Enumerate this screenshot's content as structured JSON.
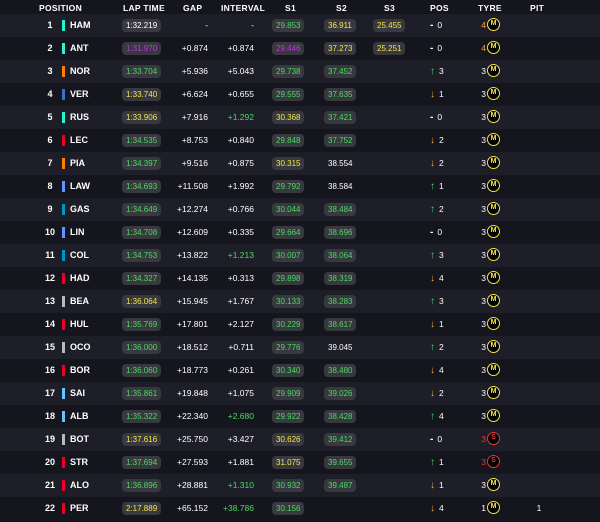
{
  "header": {
    "position": "POSITION",
    "lap_time": "LAP TIME",
    "gap": "GAP",
    "interval": "INTERVAL",
    "s1": "S1",
    "s2": "S2",
    "s3": "S3",
    "pos": "POS",
    "tyre": "TYRE",
    "pit": "PIT"
  },
  "colors": {
    "purple": "#c930e8",
    "green": "#4cd964",
    "yellow": "#f4e64a",
    "medium_tyre": "#f4e64a",
    "soft_tyre": "#e23a3a"
  },
  "rows": [
    {
      "pos": "1",
      "code": "HAM",
      "team": "#27f4d2",
      "lap": "1:32.219",
      "lap_c": "white",
      "gap": "-",
      "int": "-",
      "int_c": "white",
      "s1": "29.853",
      "s1_c": "green",
      "s2": "36.911",
      "s2_c": "yellow",
      "s3": "25.455",
      "s3_c": "yellow",
      "dir": "none",
      "pc": "0",
      "tl": "4",
      "tl_c": "orange",
      "tyre": "M",
      "pit": ""
    },
    {
      "pos": "2",
      "code": "ANT",
      "team": "#27f4d2",
      "lap": "1:31.970",
      "lap_c": "purple",
      "gap": "+0.874",
      "int": "+0.874",
      "int_c": "white",
      "s1": "29.446",
      "s1_c": "purple",
      "s2": "37.273",
      "s2_c": "yellow",
      "s3": "25.251",
      "s3_c": "yellow",
      "dir": "none",
      "pc": "0",
      "tl": "4",
      "tl_c": "orange",
      "tyre": "M",
      "pit": ""
    },
    {
      "pos": "3",
      "code": "NOR",
      "team": "#ff8000",
      "lap": "1:33.704",
      "lap_c": "green",
      "gap": "+5.936",
      "int": "+5.043",
      "int_c": "white",
      "s1": "29.738",
      "s1_c": "green",
      "s2": "37.452",
      "s2_c": "green",
      "s3": "",
      "s3_c": "white",
      "dir": "up",
      "pc": "3",
      "tl": "3",
      "tl_c": "white",
      "tyre": "M",
      "pit": ""
    },
    {
      "pos": "4",
      "code": "VER",
      "team": "#3671c6",
      "lap": "1:33.740",
      "lap_c": "yellow",
      "gap": "+6.624",
      "int": "+0.655",
      "int_c": "white",
      "s1": "29.555",
      "s1_c": "green",
      "s2": "37.635",
      "s2_c": "green",
      "s3": "",
      "s3_c": "white",
      "dir": "down",
      "pc": "1",
      "tl": "3",
      "tl_c": "white",
      "tyre": "M",
      "pit": ""
    },
    {
      "pos": "5",
      "code": "RUS",
      "team": "#27f4d2",
      "lap": "1:33.906",
      "lap_c": "yellow",
      "gap": "+7.916",
      "int": "+1.292",
      "int_c": "green",
      "s1": "30.368",
      "s1_c": "yellow",
      "s2": "37.421",
      "s2_c": "green",
      "s3": "",
      "s3_c": "white",
      "dir": "none",
      "pc": "0",
      "tl": "3",
      "tl_c": "white",
      "tyre": "M",
      "pit": ""
    },
    {
      "pos": "6",
      "code": "LEC",
      "team": "#e8002d",
      "lap": "1:34.535",
      "lap_c": "green",
      "gap": "+8.753",
      "int": "+0.840",
      "int_c": "white",
      "s1": "29.848",
      "s1_c": "green",
      "s2": "37.752",
      "s2_c": "green",
      "s3": "",
      "s3_c": "white",
      "dir": "down",
      "pc": "2",
      "tl": "3",
      "tl_c": "white",
      "tyre": "M",
      "pit": ""
    },
    {
      "pos": "7",
      "code": "PIA",
      "team": "#ff8000",
      "lap": "1:34.397",
      "lap_c": "green",
      "gap": "+9.516",
      "int": "+0.875",
      "int_c": "white",
      "s1": "30.315",
      "s1_c": "yellow",
      "s2": "38.554",
      "s2_c": "white",
      "s3": "",
      "s3_c": "white",
      "dir": "down",
      "pc": "2",
      "tl": "3",
      "tl_c": "white",
      "tyre": "M",
      "pit": ""
    },
    {
      "pos": "8",
      "code": "LAW",
      "team": "#6692ff",
      "lap": "1:34.693",
      "lap_c": "green",
      "gap": "+11.508",
      "int": "+1.992",
      "int_c": "white",
      "s1": "29.792",
      "s1_c": "green",
      "s2": "38.584",
      "s2_c": "white",
      "s3": "",
      "s3_c": "white",
      "dir": "up",
      "pc": "1",
      "tl": "3",
      "tl_c": "white",
      "tyre": "M",
      "pit": ""
    },
    {
      "pos": "9",
      "code": "GAS",
      "team": "#0093cc",
      "lap": "1:34.649",
      "lap_c": "green",
      "gap": "+12.274",
      "int": "+0.766",
      "int_c": "white",
      "s1": "30.044",
      "s1_c": "green",
      "s2": "38.484",
      "s2_c": "green",
      "s3": "",
      "s3_c": "white",
      "dir": "up",
      "pc": "2",
      "tl": "3",
      "tl_c": "white",
      "tyre": "M",
      "pit": ""
    },
    {
      "pos": "10",
      "code": "LIN",
      "team": "#6692ff",
      "lap": "1:34.708",
      "lap_c": "green",
      "gap": "+12.609",
      "int": "+0.335",
      "int_c": "white",
      "s1": "29.664",
      "s1_c": "green",
      "s2": "38.696",
      "s2_c": "green",
      "s3": "",
      "s3_c": "white",
      "dir": "none",
      "pc": "0",
      "tl": "3",
      "tl_c": "white",
      "tyre": "M",
      "pit": ""
    },
    {
      "pos": "11",
      "code": "COL",
      "team": "#0093cc",
      "lap": "1:34.753",
      "lap_c": "green",
      "gap": "+13.822",
      "int": "+1.213",
      "int_c": "green",
      "s1": "30.007",
      "s1_c": "green",
      "s2": "38.064",
      "s2_c": "green",
      "s3": "",
      "s3_c": "white",
      "dir": "up",
      "pc": "3",
      "tl": "3",
      "tl_c": "white",
      "tyre": "M",
      "pit": ""
    },
    {
      "pos": "12",
      "code": "HAD",
      "team": "#e8002d",
      "lap": "1:34.327",
      "lap_c": "green",
      "gap": "+14.135",
      "int": "+0.313",
      "int_c": "white",
      "s1": "29.898",
      "s1_c": "green",
      "s2": "38.319",
      "s2_c": "green",
      "s3": "",
      "s3_c": "white",
      "dir": "down",
      "pc": "4",
      "tl": "3",
      "tl_c": "white",
      "tyre": "M",
      "pit": ""
    },
    {
      "pos": "13",
      "code": "BEA",
      "team": "#b6babd",
      "lap": "1:36.064",
      "lap_c": "yellow",
      "gap": "+15.945",
      "int": "+1.767",
      "int_c": "white",
      "s1": "30.133",
      "s1_c": "green",
      "s2": "38.283",
      "s2_c": "green",
      "s3": "",
      "s3_c": "white",
      "dir": "up",
      "pc": "3",
      "tl": "3",
      "tl_c": "white",
      "tyre": "M",
      "pit": ""
    },
    {
      "pos": "14",
      "code": "HUL",
      "team": "#e8002d",
      "lap": "1:35.769",
      "lap_c": "green",
      "gap": "+17.801",
      "int": "+2.127",
      "int_c": "white",
      "s1": "30.229",
      "s1_c": "green",
      "s2": "38.617",
      "s2_c": "green",
      "s3": "",
      "s3_c": "white",
      "dir": "down",
      "pc": "1",
      "tl": "3",
      "tl_c": "white",
      "tyre": "M",
      "pit": ""
    },
    {
      "pos": "15",
      "code": "OCO",
      "team": "#b6babd",
      "lap": "1:36.000",
      "lap_c": "green",
      "gap": "+18.512",
      "int": "+0.711",
      "int_c": "white",
      "s1": "29.776",
      "s1_c": "green",
      "s2": "39.045",
      "s2_c": "white",
      "s3": "",
      "s3_c": "white",
      "dir": "up",
      "pc": "2",
      "tl": "3",
      "tl_c": "white",
      "tyre": "M",
      "pit": ""
    },
    {
      "pos": "16",
      "code": "BOR",
      "team": "#e8002d",
      "lap": "1:36.060",
      "lap_c": "green",
      "gap": "+18.773",
      "int": "+0.261",
      "int_c": "white",
      "s1": "30.340",
      "s1_c": "green",
      "s2": "38.480",
      "s2_c": "green",
      "s3": "",
      "s3_c": "white",
      "dir": "down",
      "pc": "4",
      "tl": "3",
      "tl_c": "white",
      "tyre": "M",
      "pit": ""
    },
    {
      "pos": "17",
      "code": "SAI",
      "team": "#64c4ff",
      "lap": "1:35.861",
      "lap_c": "green",
      "gap": "+19.848",
      "int": "+1.075",
      "int_c": "white",
      "s1": "29.909",
      "s1_c": "green",
      "s2": "39.026",
      "s2_c": "green",
      "s3": "",
      "s3_c": "white",
      "dir": "down",
      "pc": "2",
      "tl": "3",
      "tl_c": "white",
      "tyre": "M",
      "pit": ""
    },
    {
      "pos": "18",
      "code": "ALB",
      "team": "#64c4ff",
      "lap": "1:35.322",
      "lap_c": "green",
      "gap": "+22.340",
      "int": "+2.680",
      "int_c": "green",
      "s1": "29.922",
      "s1_c": "green",
      "s2": "38.428",
      "s2_c": "green",
      "s3": "",
      "s3_c": "white",
      "dir": "up",
      "pc": "4",
      "tl": "3",
      "tl_c": "white",
      "tyre": "M",
      "pit": ""
    },
    {
      "pos": "19",
      "code": "BOT",
      "team": "#b6babd",
      "lap": "1:37.616",
      "lap_c": "yellow",
      "gap": "+25.750",
      "int": "+3.427",
      "int_c": "white",
      "s1": "30.626",
      "s1_c": "yellow",
      "s2": "39.412",
      "s2_c": "green",
      "s3": "",
      "s3_c": "white",
      "dir": "none",
      "pc": "0",
      "tl": "3",
      "tl_c": "red",
      "tyre": "S",
      "pit": ""
    },
    {
      "pos": "20",
      "code": "STR",
      "team": "#e8002d",
      "lap": "1:37.694",
      "lap_c": "green",
      "gap": "+27.593",
      "int": "+1.881",
      "int_c": "white",
      "s1": "31.075",
      "s1_c": "yellow",
      "s2": "39.655",
      "s2_c": "green",
      "s3": "",
      "s3_c": "white",
      "dir": "up",
      "pc": "1",
      "tl": "3",
      "tl_c": "red",
      "tyre": "S",
      "pit": ""
    },
    {
      "pos": "21",
      "code": "ALO",
      "team": "#e8002d",
      "lap": "1:36.896",
      "lap_c": "green",
      "gap": "+28.881",
      "int": "+1.310",
      "int_c": "green",
      "s1": "30.932",
      "s1_c": "green",
      "s2": "39.487",
      "s2_c": "green",
      "s3": "",
      "s3_c": "white",
      "dir": "down",
      "pc": "1",
      "tl": "3",
      "tl_c": "white",
      "tyre": "M",
      "pit": ""
    },
    {
      "pos": "22",
      "code": "PER",
      "team": "#e8002d",
      "lap": "2:17.889",
      "lap_c": "yellow",
      "gap": "+65.152",
      "int": "+38.786",
      "int_c": "green",
      "s1": "30.156",
      "s1_c": "green",
      "s2": "",
      "s2_c": "white",
      "s3": "",
      "s3_c": "white",
      "dir": "down",
      "pc": "4",
      "tl": "1",
      "tl_c": "white",
      "tyre": "M",
      "pit": "1"
    }
  ]
}
